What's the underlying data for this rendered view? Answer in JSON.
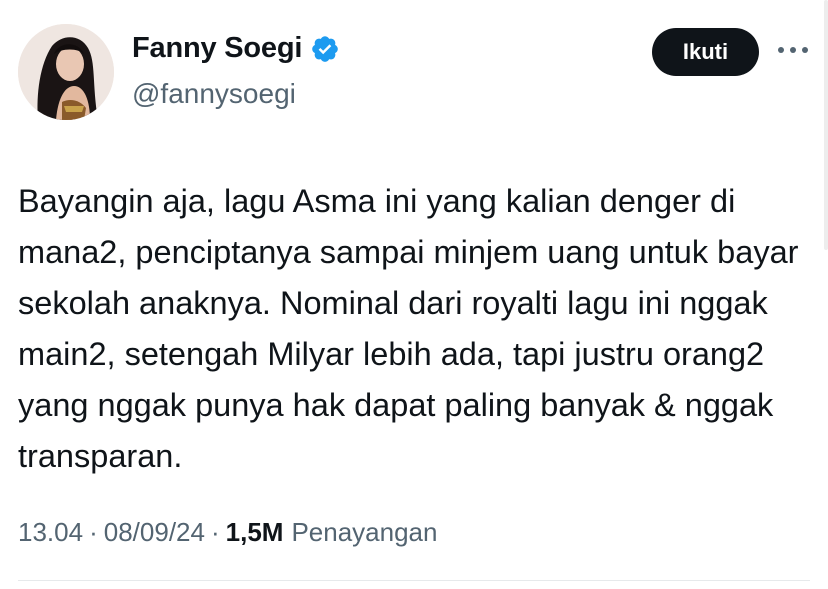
{
  "author": {
    "name": "Fanny Soegi",
    "handle": "@fannysoegi",
    "verified": true,
    "verified_color": "#1d9bf0"
  },
  "follow_button": {
    "label": "Ikuti"
  },
  "more_button": {
    "icon": "more-horizontal-icon"
  },
  "tweet": {
    "text": "Bayangin aja, lagu Asma ini yang kalian denger di mana2, penciptanya sampai minjem uang untuk bayar sekolah anaknya. Nominal dari royalti lagu ini nggak main2, setengah Milyar lebih ada, tapi justru orang2 yang nggak punya hak dapat paling banyak & nggak transparan."
  },
  "meta": {
    "time": "13.04",
    "separator": "·",
    "date": "08/09/24",
    "views_count": "1,5M",
    "views_label": "Penayangan"
  }
}
